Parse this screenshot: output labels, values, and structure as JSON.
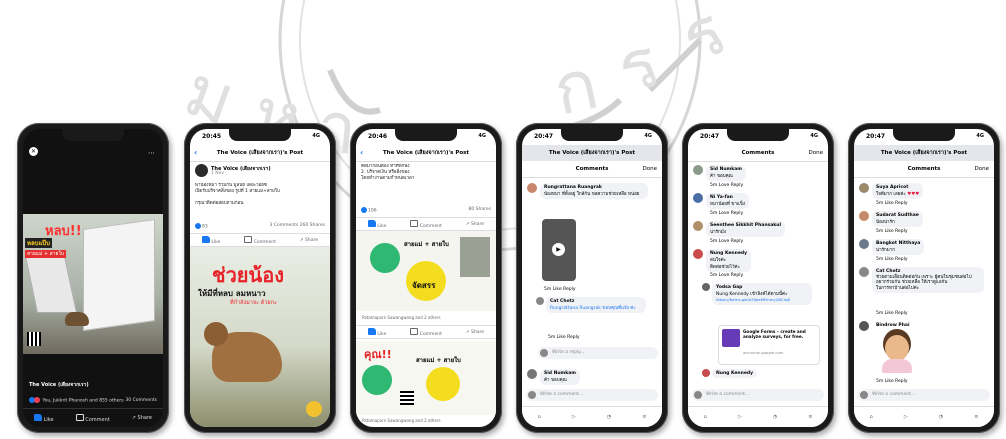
{
  "watermark": {
    "color": "#cfcfcf"
  },
  "phones": [
    {
      "video_overlay": {
        "headline": "หลบ!!",
        "sub": "หลบแป๊บ",
        "caption": "สายแม่ + สายใบ"
      },
      "page_name": "The Voice (เสียงจากเรา)",
      "reactions_text": "You, Jukkrit Phanosh and 855 others",
      "comments_count": "30 Comments",
      "like": "Like",
      "comment": "Comment",
      "share": "Share"
    },
    {
      "time": "20:45",
      "signal": "4G",
      "header": "The Voice (เสียงจากเรา)'s Post",
      "page_name": "The Voice (เสียงจากเรา)",
      "post_time": "1 Nov",
      "body": "พาน้องหมา ร่วมกัน มูลนิธิ เดอะวอยซ์\nเปิดรับบริจาคสิ่งของ รูปที่ 1 สายแม่+สายใบ\n\nกรุณาติดต่อสอบถามก่อน",
      "reactions": "83",
      "comments_shares": "3 Comments 260 Shares",
      "like": "Like",
      "comment": "Comment",
      "share": "Share",
      "poster_title": "ช่วยน้อง",
      "poster_sub": "ให้มีที่หลบ ลมหนาว",
      "poster_sub2": "ที่กำลังมาจะ ด้วยกะ"
    },
    {
      "time": "20:46",
      "signal": "4G",
      "header": "The Voice (เสียงจากเรา)'s Post",
      "body": "คิดมาก่อนต้อง ทำที่พักพิง\n2. บริจาคเงิน หรือสิ่งของ\nโดยทำงานตามกำหนดเวลา",
      "reactions": "106",
      "shares": "80 Shares",
      "like": "Like",
      "comment": "Comment",
      "share": "Share",
      "poster1_text": "สายแม่ + สายใบ",
      "poster1_badge": "จัดสรร",
      "poster2_title": "คุณ!!",
      "poster2_text": "สายแม่ + สายใบ",
      "tag_line1": "Patamaporn Sawangwong and 2 others",
      "tag_line2": "Patamaporn Sawangwong and 2 others"
    },
    {
      "time": "20:47",
      "signal": "4G",
      "header": "The Voice (เสียงจากเรา)'s Post",
      "title": "Comments",
      "done": "Done",
      "c1_name": "Rungrattana Ruangrak",
      "c1_text": "น้องหมา ที่ตั้งอยู่ ใกล้กัน ขอความช่วยเหลือ หน่อย",
      "c1_meta": "5m  Like  Reply",
      "c2_name": "Cat Chotz",
      "c2_text": "Rungrattana Ruangrak ขอบคุณที่แจ้ง ค่ะ",
      "c2_meta": "5m  Like  Reply",
      "write": "Write a reply...",
      "c3_name": "Sid Numkam",
      "c3_text": "ค้า ขอบคุณ",
      "write_comment": "Write a comment..."
    },
    {
      "time": "20:47",
      "signal": "4G",
      "title": "Comments",
      "done": "Done",
      "c1_name": "Sid Numkam",
      "c1_text": "ค้า ขอบคุณ",
      "c2_name": "Ni Ya-fan",
      "c2_text": "หมาน้อยที่ ขาแข็ง",
      "c3_name": "Seenthee Sikkhit Phansakul",
      "c3_text": "น่ารักมั่ง",
      "c4_name": "Nung Kennedy",
      "c4_text": "สนใจค่ะ\nติดต่อช่วยไว้ค่ะ",
      "c5_name": "Yodsa Gap",
      "c5_text": "Nung Kennedy เข้าลิงค์ได้ตามนี้ค่ะ",
      "link": "https://forms.gle/a7fjbaMFmmyQKCrq8",
      "card_title": "Google Forms – create and analyze surveys, for free.",
      "card_url": "accounts.google.com",
      "c6_name": "Nung Kennedy",
      "meta": "5m  Love  Reply",
      "write_comment": "Write a comment..."
    },
    {
      "time": "20:47",
      "signal": "4G",
      "header": "The Voice (เสียงจากเรา)'s Post",
      "title": "Comments",
      "done": "Done",
      "c1_name": "Suya Apricot",
      "c1_text": "ใจดีมาก เลยค่ะ",
      "c2_name": "Sudarat Sudthae",
      "c2_text": "น้องน่ารัก",
      "c3_name": "Bangkot Nitthaya",
      "c3_text": "น่ารักมาก",
      "c4_name": "Cat Chotz",
      "c4_text": "ช่วยตามเลื่อนติดต่อกัน เพราะ ผู้คนในชุมชนต่อไป\nอยากร่วมกัน ช่วยเหลือ ให้เราดูแลกัน\nในการหาบ้านต่อไปค่ะ",
      "c5_name": "Bindrow Phai",
      "meta": "5m  Like  Reply",
      "write_comment": "Write a comment..."
    }
  ]
}
